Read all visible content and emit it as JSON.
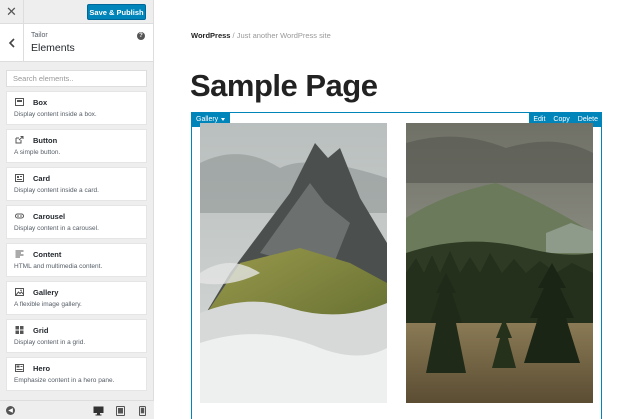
{
  "sidebar": {
    "publish_label": "Save & Publish",
    "panel_sub": "Tailor",
    "panel_title": "Elements",
    "search_placeholder": "Search elements..",
    "items": [
      {
        "title": "Box",
        "desc": "Display content inside a box.",
        "icon": "box-icon"
      },
      {
        "title": "Button",
        "desc": "A simple button.",
        "icon": "external-link-icon"
      },
      {
        "title": "Card",
        "desc": "Display content inside a card.",
        "icon": "card-icon"
      },
      {
        "title": "Carousel",
        "desc": "Display content in a carousel.",
        "icon": "carousel-icon"
      },
      {
        "title": "Content",
        "desc": "HTML and multimedia content.",
        "icon": "text-align-icon"
      },
      {
        "title": "Gallery",
        "desc": "A flexible image gallery.",
        "icon": "image-icon"
      },
      {
        "title": "Grid",
        "desc": "Display content in a grid.",
        "icon": "grid-icon"
      },
      {
        "title": "Hero",
        "desc": "Emphasize content in a hero pane.",
        "icon": "hero-icon"
      }
    ]
  },
  "preview": {
    "site_name": "WordPress",
    "site_separator": " / ",
    "site_tagline": "Just another WordPress site",
    "page_title": "Sample Page",
    "gallery_label": "Gallery",
    "controls": [
      "Edit",
      "Copy",
      "Delete"
    ]
  },
  "colors": {
    "accent": "#0085ba",
    "sidebar_bg": "#eeeeee"
  }
}
